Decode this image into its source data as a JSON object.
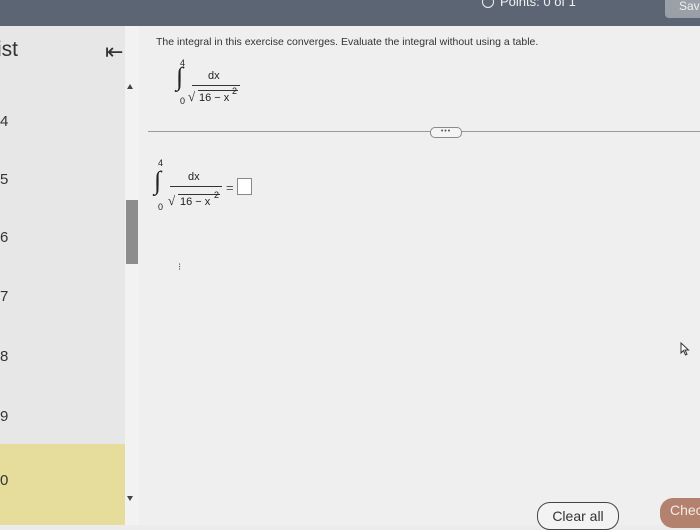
{
  "header": {
    "points_label": "Points: 0 of 1",
    "save_label": "Sav"
  },
  "sidebar": {
    "title": "ist",
    "question_numbers": [
      "4",
      "5",
      "6",
      "7",
      "8",
      "9",
      "0"
    ]
  },
  "question": {
    "prompt": "The integral in this exercise converges. Evaluate the integral without using a table.",
    "integral": {
      "upper": "4",
      "lower": "0",
      "numerator": "dx",
      "denominator": "16 − x",
      "exponent": "2"
    },
    "equals": "=",
    "answer_value": ""
  },
  "more_label": "•••",
  "footer": {
    "clear_label": "Clear all",
    "check_label": "Chec"
  }
}
